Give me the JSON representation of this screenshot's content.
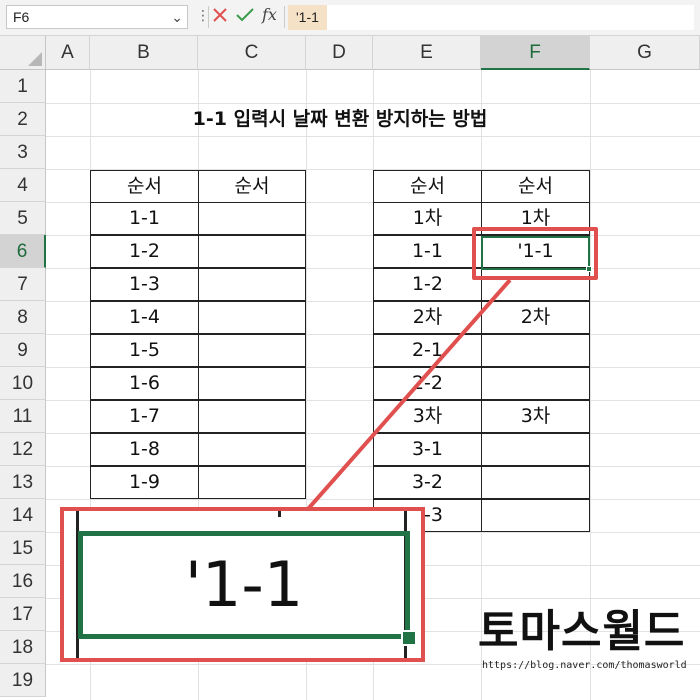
{
  "formula_bar": {
    "name_box": "F6",
    "formula_value": "'1-1"
  },
  "columns": [
    "A",
    "B",
    "C",
    "D",
    "E",
    "F",
    "G"
  ],
  "rows": [
    "1",
    "2",
    "3",
    "4",
    "5",
    "6",
    "7",
    "8",
    "9",
    "10",
    "11",
    "12",
    "13",
    "14",
    "15",
    "16",
    "17",
    "18",
    "19"
  ],
  "title": "1-1 입력시 날짜 변환 방지하는 방법",
  "left_table": {
    "headers": [
      "순서",
      "순서"
    ],
    "col_b": [
      "1-1",
      "1-2",
      "1-3",
      "1-4",
      "1-5",
      "1-6",
      "1-7",
      "1-8",
      "1-9"
    ]
  },
  "right_table": {
    "headers": [
      "순서",
      "순서"
    ],
    "col_e": [
      "1차",
      "1-1",
      "1-2",
      "2차",
      "2-1",
      "2-2",
      "3차",
      "3-1",
      "3-2",
      "3-3"
    ],
    "col_f": [
      "1차",
      "'1-1",
      "",
      "2차",
      "",
      "",
      "3차",
      "",
      "",
      ""
    ]
  },
  "zoom_text": "'1-1",
  "watermark": {
    "text": "토마스월드",
    "url": "https://blog.naver.com/thomasworld"
  },
  "colors": {
    "excel_green": "#217346",
    "highlight_red": "#e0504f",
    "formula_highlight": "#f5e2c6"
  }
}
